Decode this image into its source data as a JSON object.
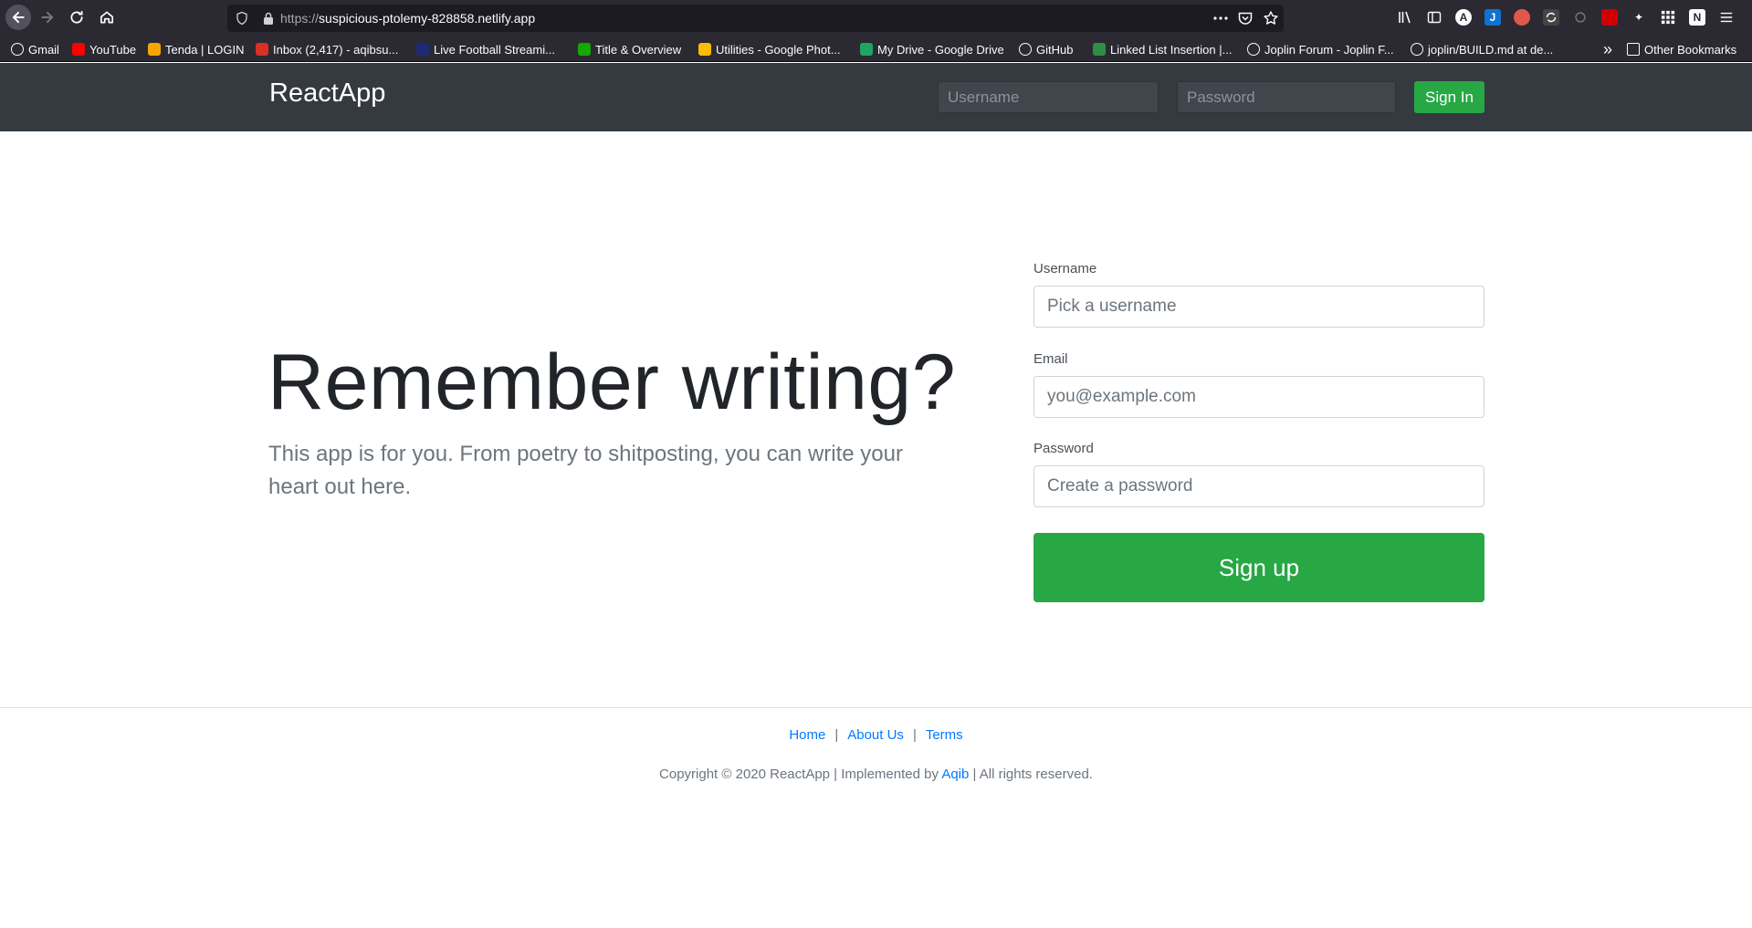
{
  "browser": {
    "url_scheme": "https://",
    "url_host": "suspicious-ptolemy-828858.netlify.app",
    "bookmarks": [
      {
        "label": "Gmail",
        "icon": "globe-icon",
        "color": "#fbfbfe"
      },
      {
        "label": "YouTube",
        "icon": "youtube-icon",
        "color": "#ff0000"
      },
      {
        "label": "Tenda | LOGIN",
        "icon": "tenda-icon",
        "color": "#f7a600"
      },
      {
        "label": "Inbox (2,417) - aqibsu...",
        "icon": "gmail-icon",
        "color": "#d93025"
      },
      {
        "label": "Live Football Streami...",
        "icon": "streaming-icon",
        "color": "#1e2a78"
      },
      {
        "label": "Title & Overview",
        "icon": "upwork-icon",
        "color": "#14a800"
      },
      {
        "label": "Utilities - Google Phot...",
        "icon": "google-photos-icon",
        "color": "#fbbc04"
      },
      {
        "label": "My Drive - Google Drive",
        "icon": "google-drive-icon",
        "color": "#1fa463"
      },
      {
        "label": "GitHub",
        "icon": "github-icon",
        "color": "#fbfbfe"
      },
      {
        "label": "Linked List Insertion |...",
        "icon": "gfg-icon",
        "color": "#2f8d46"
      },
      {
        "label": "Joplin Forum - Joplin F...",
        "icon": "globe-icon",
        "color": "#fbfbfe"
      },
      {
        "label": "joplin/BUILD.md at de...",
        "icon": "github-icon",
        "color": "#fbfbfe"
      }
    ],
    "other_bookmarks": "Other Bookmarks"
  },
  "navbar": {
    "brand": "ReactApp",
    "username_placeholder": "Username",
    "password_placeholder": "Password",
    "signin_label": "Sign In"
  },
  "hero": {
    "title": "Remember writing?",
    "subtitle": "This app is for you. From poetry to shitposting, you can write your heart out here."
  },
  "signup": {
    "username_label": "Username",
    "username_placeholder": "Pick a username",
    "email_label": "Email",
    "email_placeholder": "you@example.com",
    "password_label": "Password",
    "password_placeholder": "Create a password",
    "submit_label": "Sign up"
  },
  "footer": {
    "links": [
      "Home",
      "About Us",
      "Terms"
    ],
    "copyright_prefix": "Copyright © 2020 ReactApp | Implemented by",
    "author": "Aqib",
    "copyright_suffix": "| All rights reserved."
  },
  "colors": {
    "accent": "#28a745",
    "navbar_bg": "#343a40",
    "link": "#007bff"
  }
}
